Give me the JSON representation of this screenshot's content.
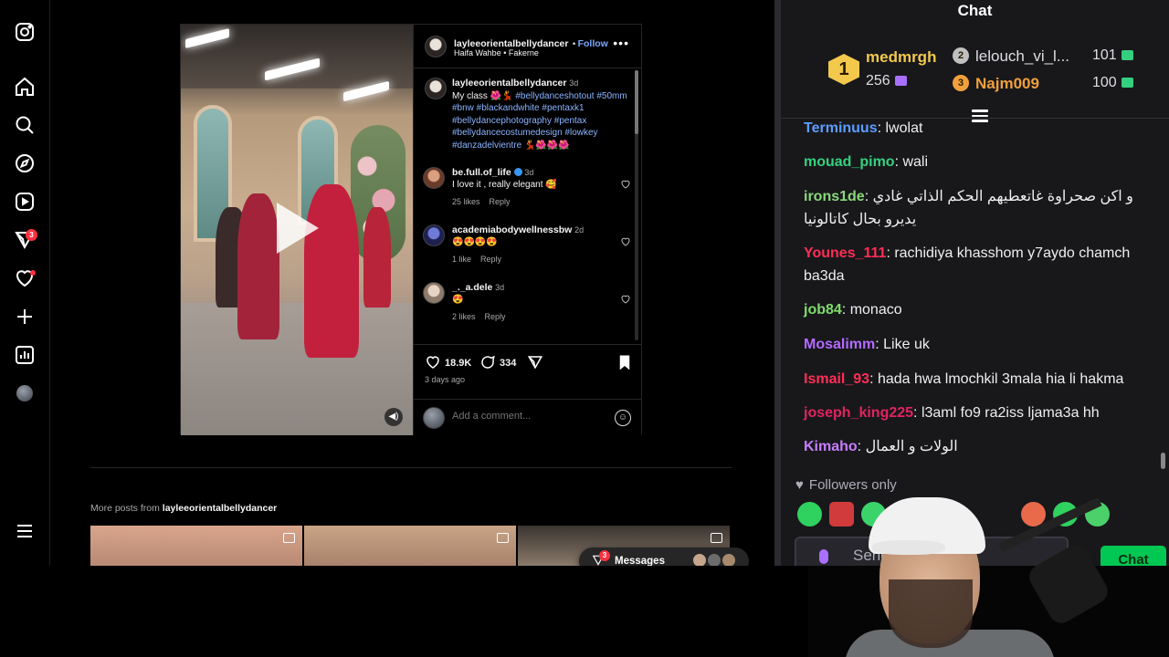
{
  "instagram": {
    "rail": {
      "icons": [
        "instagram-icon",
        "home-icon",
        "search-icon",
        "explore-icon",
        "reels-icon",
        "messages-icon",
        "notifications-icon",
        "create-icon",
        "dashboard-icon",
        "profile-avatar",
        "menu-icon"
      ],
      "messages_badge": "3"
    },
    "post": {
      "username": "layleeorientalbellydancer",
      "follow_label": "Follow",
      "audio": "Haifa Wahbe • Fakerne",
      "caption": {
        "username": "layleeorientalbellydancer",
        "age": "3d",
        "text": "My class 🌺💃",
        "tags": "#bellydanceshotout #50mm #bnw #blackandwhite #pentaxk1 #bellydancephotography #pentax #bellydancecostumedesign #lowkey #danzadelvientre",
        "tail": "💃🌺🌺🌺"
      },
      "comments": [
        {
          "user": "be.full.of_life",
          "age": "3d",
          "text": "I love it , really elegant 🥰",
          "likes": "25 likes",
          "reply": "Reply"
        },
        {
          "user": "academiabodywellnessbw",
          "age": "2d",
          "text": "😍😍😍😍",
          "likes": "1 like",
          "reply": "Reply"
        },
        {
          "user": "_._a.dele",
          "age": "3d",
          "text": "😍",
          "likes": "2 likes",
          "reply": "Reply"
        }
      ],
      "like_count": "18.9K",
      "comment_count": "334",
      "posted": "3 days ago",
      "add_comment_placeholder": "Add a comment..."
    },
    "more_posts_prefix": "More posts from ",
    "more_posts_user": "layleeorientalbellydancer",
    "messages_pill": {
      "label": "Messages",
      "badge": "3"
    }
  },
  "chat": {
    "title": "Chat",
    "leaderboard": [
      {
        "rank": "1",
        "name": "medmrgh",
        "value": "256",
        "color": "#f2c94c"
      },
      {
        "rank": "2",
        "name": "lelouch_vi_l...",
        "value": "101",
        "color": "#c0c0c0"
      },
      {
        "rank": "3",
        "name": "Najm009",
        "value": "100",
        "color": "#f2a03d"
      }
    ],
    "messages": [
      {
        "user": "Terminuus",
        "text": "lwolat",
        "color": "#5c9dff"
      },
      {
        "user": "mouad_pimo",
        "text": "wali",
        "color": "#35d07f"
      },
      {
        "user": "irons1de",
        "text": "و اكن صحراوة غاتعطيهم الحكم الذاتي غادي يديرو بحال كاتالونيا",
        "color": "#8ad97a"
      },
      {
        "user": "Younes_111",
        "text": "rachidiya khasshom y7aydo chamch ba3da",
        "color": "#ff2e55"
      },
      {
        "user": "job84",
        "text": "monaco",
        "color": "#7fdc6b"
      },
      {
        "user": "Mosalimm",
        "text": "Like uk",
        "color": "#b36bff"
      },
      {
        "user": "Ismail_93",
        "text": "hada hwa lmochkil 3mala hia li hakma",
        "color": "#ff2e55"
      },
      {
        "user": "joseph_king225",
        "text": "l3aml fo9 ra2iss ljama3a hh",
        "color": "#e0245e"
      },
      {
        "user": "Kimaho",
        "text": "الولات و العمال",
        "color": "#c77dff"
      }
    ],
    "followers_only": "Followers only",
    "send_placeholder": "Send a",
    "chat_button": "Chat"
  }
}
